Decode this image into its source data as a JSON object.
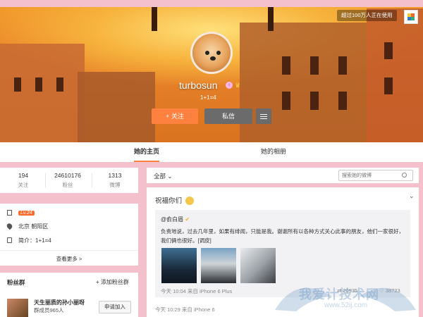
{
  "banner": {
    "badge": "超过100万人正在使用",
    "username": "turbosun",
    "bio": "1+1=4",
    "follow_label": "+ 关注",
    "message_label": "私信"
  },
  "tabs": [
    {
      "label": "她的主页",
      "active": true
    },
    {
      "label": "她的相册",
      "active": false
    }
  ],
  "stats": [
    {
      "value": "194",
      "label": "关注"
    },
    {
      "value": "24610176",
      "label": "粉丝"
    },
    {
      "value": "1313",
      "label": "微博"
    }
  ],
  "info": {
    "level": "Lv.24",
    "location": "北京 朝阳区",
    "intro": "简介：1+1=4",
    "see_more": "查看更多 >"
  },
  "fans_group": {
    "title": "粉丝群",
    "add_label": "+ 添加粉丝群",
    "group_name": "天生丽质的孙小丽呀",
    "members": "群成员965人",
    "join_label": "申请加入"
  },
  "filter": {
    "all_label": "全部",
    "search_placeholder": "搜索她的微博"
  },
  "post": {
    "text": "祝福你们",
    "repost": {
      "author": "@俞白眉",
      "text": "负责地说，过去几年里，如果有绯闻，只能是我。谢谢所有以各种方式关心此事的朋友，他们一家很好，我们俩也很好。[调皮]",
      "time_source": "今天 10:04 来自 iPhone 6 Plus",
      "forward_count": "20935",
      "like_count": "38723"
    },
    "time_source": "今天 10:29 来自 iPhone 6"
  },
  "watermark": {
    "text": "我爱计技术网",
    "sub": "www.52ij.com"
  },
  "colors": {
    "accent": "#ff8140",
    "page_bg": "#f3c0cb",
    "dark_button": "#6b6b6b"
  }
}
